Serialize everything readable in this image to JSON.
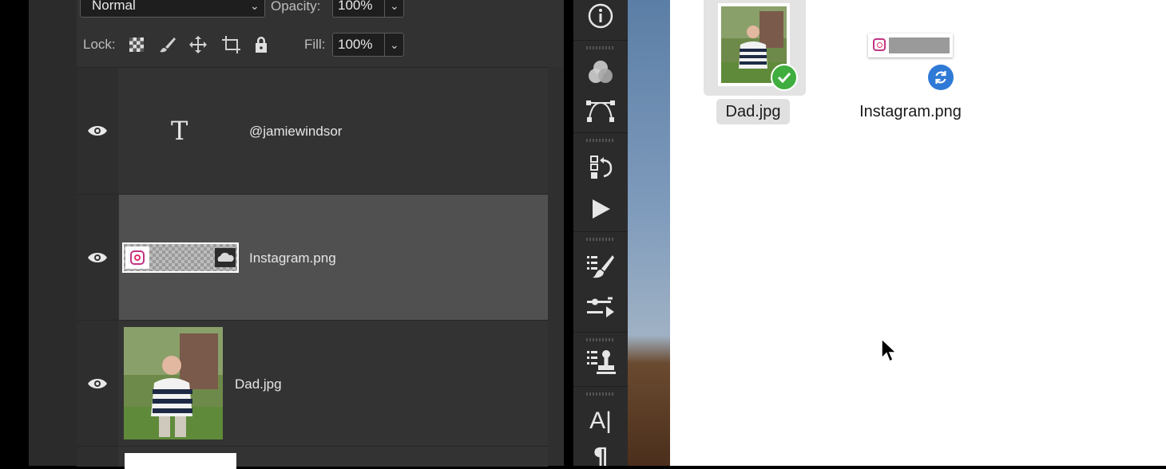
{
  "layers_panel": {
    "blend_mode": "Normal",
    "opacity_label": "Opacity:",
    "opacity_value": "100%",
    "lock_label": "Lock:",
    "fill_label": "Fill:",
    "fill_value": "100%",
    "layers": [
      {
        "name": "@jamiewindsor",
        "type": "text",
        "thumb_glyph": "T"
      },
      {
        "name": "Instagram.png",
        "type": "smart-object",
        "selected": true
      },
      {
        "name": "Dad.jpg",
        "type": "image"
      }
    ]
  },
  "toolbar": {
    "icons": [
      "info-icon",
      "channels-icon",
      "paths-icon",
      "history-icon",
      "play-icon",
      "brush-presets-icon",
      "adjustments-icon",
      "clone-source-icon",
      "character-icon",
      "paragraph-icon"
    ],
    "character_glyph": "A|",
    "paragraph_glyph": "¶"
  },
  "finder": {
    "files": [
      {
        "name": "Dad.jpg",
        "selected": true,
        "status": "synced"
      },
      {
        "name": "Instagram.png",
        "selected": false,
        "status": "syncing"
      }
    ]
  },
  "colors": {
    "panel_bg": "#323232",
    "selected_row": "#505050",
    "sync_green": "#3fae3f",
    "sync_blue": "#2f7ad6"
  }
}
